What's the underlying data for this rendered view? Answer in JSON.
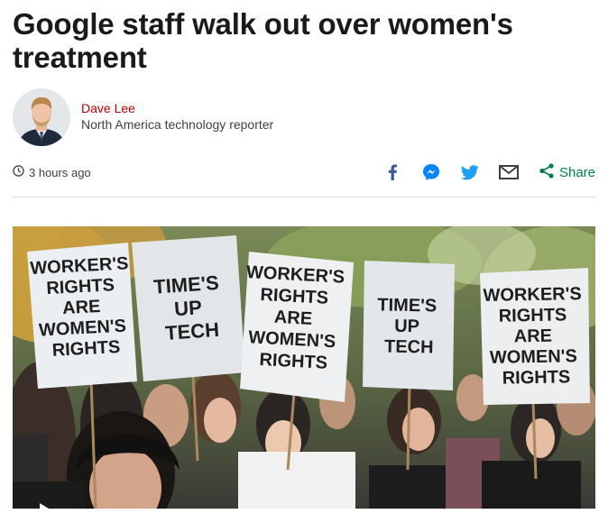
{
  "headline": "Google staff walk out over women's treatment",
  "author": {
    "name": "Dave Lee",
    "role": "North America technology reporter"
  },
  "timestamp": "3 hours ago",
  "share": {
    "icons": [
      "facebook-icon",
      "messenger-icon",
      "twitter-icon",
      "email-icon"
    ],
    "label": "Share"
  },
  "colors": {
    "author_name": "#b80000",
    "share_green": "#007f4a",
    "facebook": "#3b5998",
    "messenger": "#0084ff",
    "twitter": "#1da1f2",
    "email": "#404040"
  },
  "photo": {
    "signs": [
      [
        "WORKER'S",
        "RIGHTS",
        "ARE",
        "WOMEN'S",
        "RIGHTS"
      ],
      [
        "TIME'S",
        "UP",
        "TECH"
      ],
      [
        "WORKER'S",
        "RIGHTS",
        "ARE",
        "WOMEN'S",
        "RIGHTS"
      ],
      [
        "TIME'S",
        "UP",
        "TECH"
      ],
      [
        "WORKER'S",
        "RIGHTS",
        "ARE",
        "WOMEN'S",
        "RIGHTS"
      ]
    ]
  }
}
